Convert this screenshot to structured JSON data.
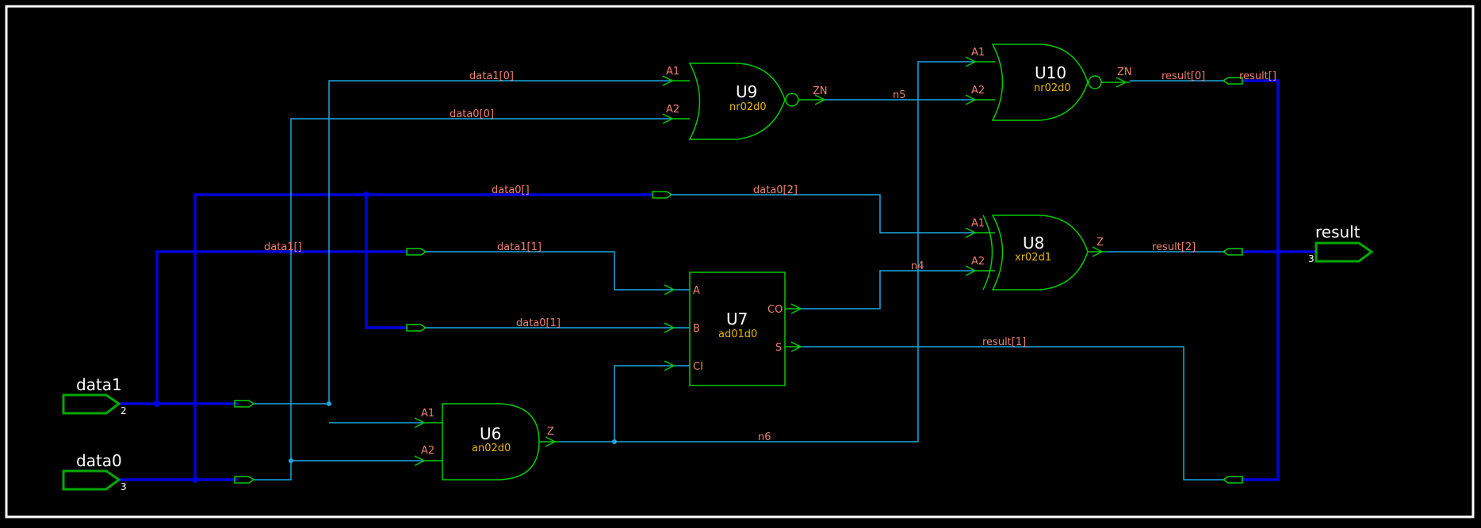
{
  "ports": {
    "data1": {
      "label": "data1",
      "width": "2"
    },
    "data0": {
      "label": "data0",
      "width": "3"
    },
    "result": {
      "label": "result",
      "width": "3"
    }
  },
  "gates": {
    "U9": {
      "name": "U9",
      "type": "nr02d0",
      "pins": {
        "A1": "A1",
        "A2": "A2",
        "ZN": "ZN"
      }
    },
    "U10": {
      "name": "U10",
      "type": "nr02d0",
      "pins": {
        "A1": "A1",
        "A2": "A2",
        "ZN": "ZN"
      }
    },
    "U8": {
      "name": "U8",
      "type": "xr02d1",
      "pins": {
        "A1": "A1",
        "A2": "A2",
        "Z": "Z"
      }
    },
    "U7": {
      "name": "U7",
      "type": "ad01d0",
      "pins": {
        "A": "A",
        "B": "B",
        "CI": "CI",
        "CO": "CO",
        "S": "S"
      }
    },
    "U6": {
      "name": "U6",
      "type": "an02d0",
      "pins": {
        "A1": "A1",
        "A2": "A2",
        "Z": "Z"
      }
    }
  },
  "nets": {
    "data1_0": "data1[0]",
    "data0_0": "data0[0]",
    "data0_bus": "data0[]",
    "data0_2": "data0[2]",
    "data1_bus": "data1[]",
    "data1_1": "data1[1]",
    "data0_1": "data0[1]",
    "n5": "n5",
    "n4": "n4",
    "n6": "n6",
    "result_0": "result[0]",
    "result_bus": "result[]",
    "result_2": "result[2]",
    "result_1": "result[1]"
  },
  "colors": {
    "background": "#000000",
    "frame": "#ffffff",
    "wire": "#1aa8e0",
    "bus": "#0000dd",
    "gate": "#00cc00",
    "pin_label": "#f08070",
    "gate_type": "#e8b800"
  }
}
